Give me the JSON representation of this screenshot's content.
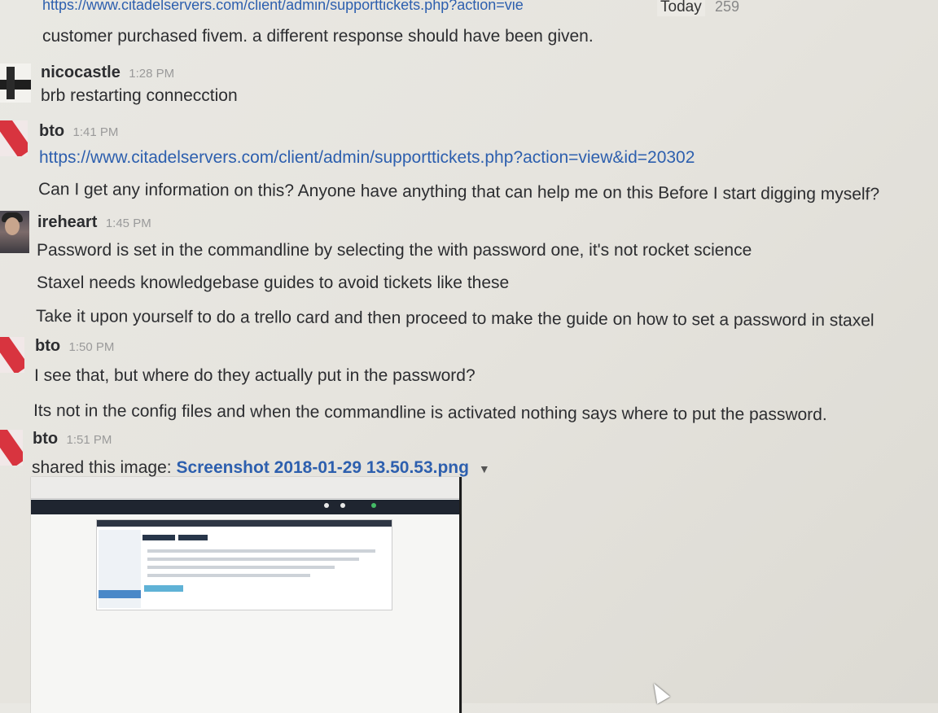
{
  "header": {
    "top_link": "https://www.citadelservers.com/client/admin/supporttickets.php?action=vie",
    "today_label": "Today",
    "count": "259"
  },
  "messages": [
    {
      "continuation": true,
      "lines": [
        "customer purchased fivem. a different response should have been given."
      ]
    },
    {
      "sender": "nicocastle",
      "time": "1:28 PM",
      "lines": [
        "brb restarting connecction"
      ]
    },
    {
      "sender": "bto",
      "time": "1:41 PM",
      "link": "https://www.citadelservers.com/client/admin/supporttickets.php?action=view&id=20302",
      "lines": [
        "Can I get any information on this? Anyone have anything that can help me on this Before I start digging myself?"
      ]
    },
    {
      "sender": "ireheart",
      "time": "1:45 PM",
      "lines": [
        "Password is set in the commandline by selecting the with password one, it's not rocket science",
        "Staxel needs knowledgebase guides to avoid tickets like these",
        "Take it upon yourself to do a trello card and then proceed to make the guide on how to set a password in staxel"
      ]
    },
    {
      "sender": "bto",
      "time": "1:50 PM",
      "lines": [
        "I see that, but where do they actually put in the password?",
        "Its not in the config files and when the commandline is activated nothing says where to put the password."
      ]
    },
    {
      "sender": "bto",
      "time": "1:51 PM",
      "shared_prefix": "shared this image:",
      "file_name": "Screenshot 2018-01-29 13.50.53.png"
    }
  ],
  "icons": {
    "dropdown": "chevron-down-icon",
    "cursor": "mouse-pointer-icon"
  },
  "colors": {
    "link": "#2d5fae",
    "avatar_red": "#d8343f"
  }
}
